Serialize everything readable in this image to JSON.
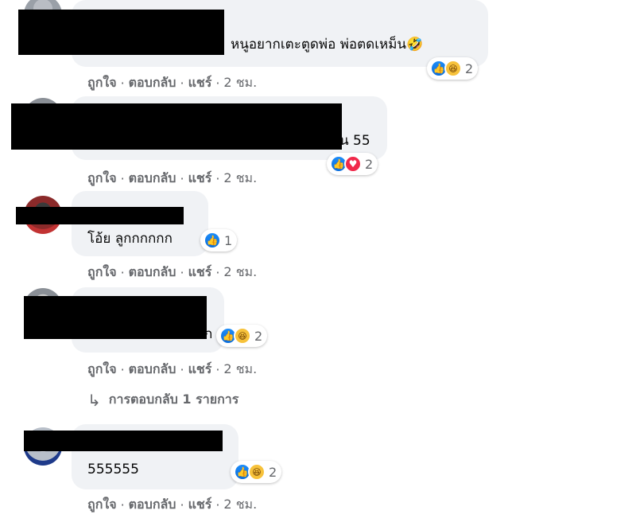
{
  "actions": {
    "like": "ถูกใจ",
    "reply": "ตอบกลับ",
    "share": "แชร์",
    "sep": "·"
  },
  "comments": [
    {
      "text": "หนูอยากเตะตูดพ่อ พ่อตดเหม็น🤣",
      "reactions": [
        "like",
        "haha"
      ],
      "count": "2",
      "time": "2 ชม."
    },
    {
      "text": "น 55",
      "reactions": [
        "like",
        "love"
      ],
      "count": "2",
      "time": "2 ชม."
    },
    {
      "text": "โอ้ย ลูกกกกกก",
      "reactions": [
        "like"
      ],
      "count": "1",
      "time": "2 ชม."
    },
    {
      "text": "ก",
      "reactions": [
        "like",
        "haha"
      ],
      "count": "2",
      "time": "2 ชม."
    },
    {
      "text": "555555",
      "reactions": [
        "like",
        "haha"
      ],
      "count": "2",
      "time": "2 ชม."
    }
  ],
  "reply_link": {
    "label": "การตอบกลับ 1 รายการ",
    "icon": "reply-arrow-icon"
  },
  "icons": {
    "like": "like-reaction-icon",
    "love": "love-reaction-icon",
    "haha": "haha-reaction-icon"
  },
  "colors": {
    "bubble": "#f0f2f5",
    "meta": "#65676b",
    "like": "#1877f2",
    "love": "#f0284a",
    "haha": "#f7c23b"
  }
}
